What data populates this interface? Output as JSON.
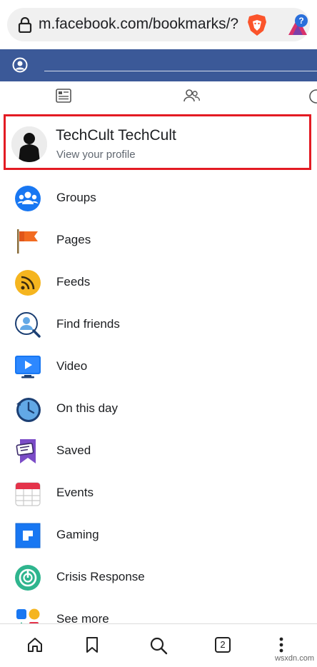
{
  "browser": {
    "url": "m.facebook.com/bookmarks/?p",
    "tab_count": "2"
  },
  "profile": {
    "name": "TechCult TechCult",
    "subtitle": "View your profile"
  },
  "menu": [
    {
      "label": "Groups",
      "icon": "groups-icon"
    },
    {
      "label": "Pages",
      "icon": "pages-flag-icon"
    },
    {
      "label": "Feeds",
      "icon": "feeds-icon"
    },
    {
      "label": "Find friends",
      "icon": "find-friends-icon"
    },
    {
      "label": "Video",
      "icon": "video-icon"
    },
    {
      "label": "On this day",
      "icon": "on-this-day-icon"
    },
    {
      "label": "Saved",
      "icon": "saved-icon"
    },
    {
      "label": "Events",
      "icon": "events-icon"
    },
    {
      "label": "Gaming",
      "icon": "gaming-icon"
    },
    {
      "label": "Crisis Response",
      "icon": "crisis-response-icon"
    },
    {
      "label": "See more",
      "icon": "see-more-icon"
    }
  ],
  "watermark": "wsxdn.com",
  "colors": {
    "facebook_blue": "#3b5998",
    "highlight_red": "#e31b23"
  }
}
